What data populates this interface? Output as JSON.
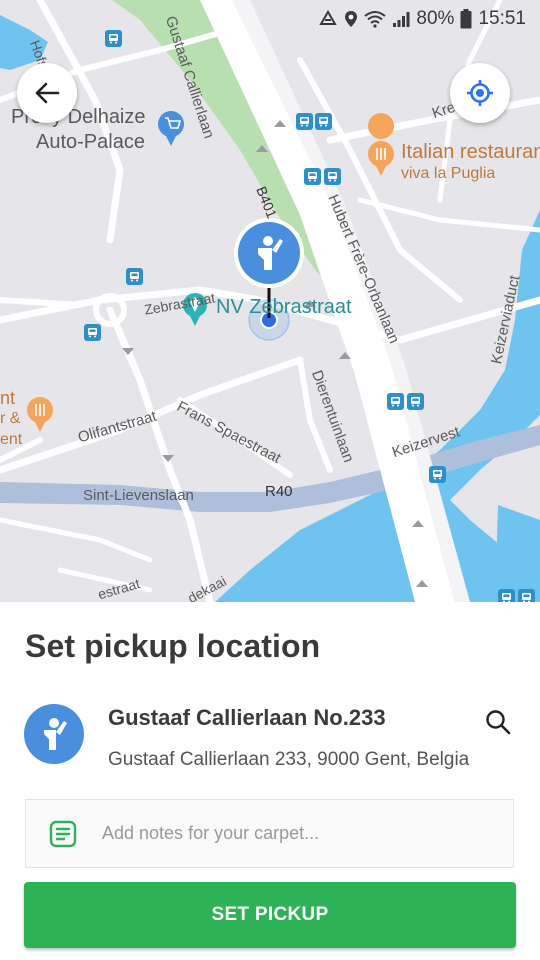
{
  "status_bar": {
    "battery": "80%",
    "time": "15:51",
    "icons": [
      "data-saver-icon",
      "location-icon",
      "wifi-icon",
      "signal-icon",
      "battery-icon"
    ]
  },
  "map": {
    "controls": {
      "back_icon": "arrow-left-icon",
      "locate_icon": "my-location-icon"
    },
    "labels": {
      "hofstraat": "Hofstraat",
      "gustaaf_callierlaan": "Gustaaf Callierlaan",
      "proxy_delhaize": "Proxy Delhaize",
      "auto_palace": "Auto-Palace",
      "krev": "Krev",
      "italian_restaurant": "Italian restauran",
      "viva_la_puglia": "viva la Puglia",
      "b401": "B401",
      "hubert_frere_orbanlaan": "Hubert Frère-Orbanlaan",
      "keizerviaduct": "Keizerviaduct",
      "zebrastraat_street": "Zebrastraat",
      "nv_zebrastraat": "NV Zebrastraat",
      "dierentuinlaan": "Dierentuinlaan",
      "frans_spaestraat": "Frans Spaestraat",
      "olifantstraat": "Olifantstraat",
      "keizervest": "Keizervest",
      "sint_lievenslaan": "Sint-Lievenslaan",
      "r40": "R40",
      "nt": "nt",
      "r_amp": "r &",
      "ent": "ent",
      "estraat": "estraat",
      "dekaai": "dekaai"
    },
    "colors": {
      "background": "#e6e6ea",
      "park": "#b8dfb0",
      "water": "#6ec3ef",
      "ring_road": "#aebfdb",
      "bus_stop": "#2f8fc9",
      "restaurant_poi": "#f4a55b",
      "pin": "#4a8fdd"
    }
  },
  "sheet": {
    "title": "Set pickup location",
    "address_title": "Gustaaf Callierlaan No.233",
    "address_sub": "Gustaaf Callierlaan 233, 9000 Gent, Belgia",
    "avatar_icon": "person-hand-raised-icon",
    "search_icon": "search-icon",
    "notes_icon": "note-icon",
    "notes_placeholder": "Add notes for your carpet...",
    "notes_value": "",
    "button_label": "SET PICKUP",
    "colors": {
      "primary": "#2db356",
      "avatar": "#4a8fdd"
    }
  }
}
